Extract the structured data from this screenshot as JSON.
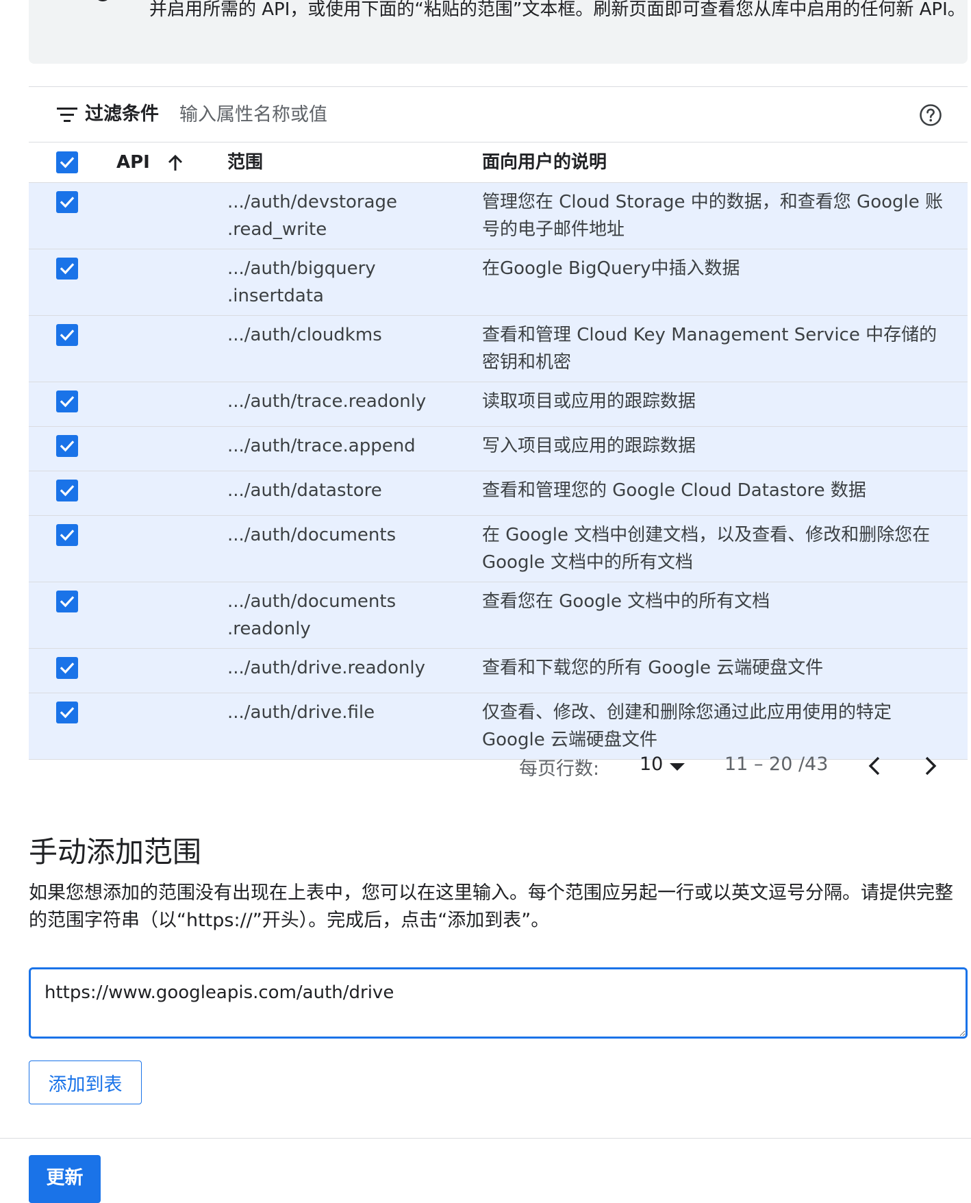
{
  "info": {
    "text": "并启用所需的 API，或使用下面的“粘贴的范围”文本框。刷新页面即可查看您从库中启用的任何新 API。"
  },
  "filter": {
    "label": "过滤条件",
    "placeholder": "输入属性名称或值"
  },
  "table": {
    "headers": {
      "api": "API",
      "scope": "范围",
      "description": "面向用户的说明"
    },
    "rows": [
      {
        "api": "",
        "scope": ".../auth/devstorage\n.read_write",
        "description": "管理您在 Cloud Storage 中的数据，和查看您 Google 账号的电子邮件地址",
        "checked": true
      },
      {
        "api": "",
        "scope": ".../auth/bigquery\n.insertdata",
        "description": "在Google BigQuery中插入数据",
        "checked": true
      },
      {
        "api": "",
        "scope": ".../auth/cloudkms",
        "description": "查看和管理 Cloud Key Management Service 中存储的密钥和机密",
        "checked": true
      },
      {
        "api": "",
        "scope": ".../auth/trace.readonly",
        "description": "读取项目或应用的跟踪数据",
        "checked": true
      },
      {
        "api": "",
        "scope": ".../auth/trace.append",
        "description": "写入项目或应用的跟踪数据",
        "checked": true
      },
      {
        "api": "",
        "scope": ".../auth/datastore",
        "description": "查看和管理您的 Google Cloud Datastore 数据",
        "checked": true
      },
      {
        "api": "",
        "scope": ".../auth/documents",
        "description": "在 Google 文档中创建文档，以及查看、修改和删除您在 Google 文档中的所有文档",
        "checked": true
      },
      {
        "api": "",
        "scope": ".../auth/documents\n.readonly",
        "description": "查看您在 Google 文档中的所有文档",
        "checked": true
      },
      {
        "api": "",
        "scope": ".../auth/drive.readonly",
        "description": "查看和下载您的所有 Google 云端硬盘文件",
        "checked": true
      },
      {
        "api": "",
        "scope": ".../auth/drive.file",
        "description": "仅查看、修改、创建和删除您通过此应用使用的特定 Google 云端硬盘文件",
        "checked": true
      }
    ]
  },
  "pagination": {
    "rows_per_page_label": "每页行数:",
    "rows_per_page": "10",
    "range": "11 – 20 /43"
  },
  "manual": {
    "title": "手动添加范围",
    "description": "如果您想添加的范围没有出现在上表中，您可以在这里输入。每个范围应另起一行或以英文逗号分隔。请提供完整的范围字符串（以“https://”开头）。完成后，点击“添加到表”。",
    "textarea_value": "https://www.googleapis.com/auth/drive\n",
    "add_button_label": "添加到表"
  },
  "footer": {
    "update_button_label": "更新"
  },
  "colors": {
    "accent": "#1a73e8",
    "row_selected": "#e8f0fe",
    "info_bg": "#f1f3f4"
  }
}
